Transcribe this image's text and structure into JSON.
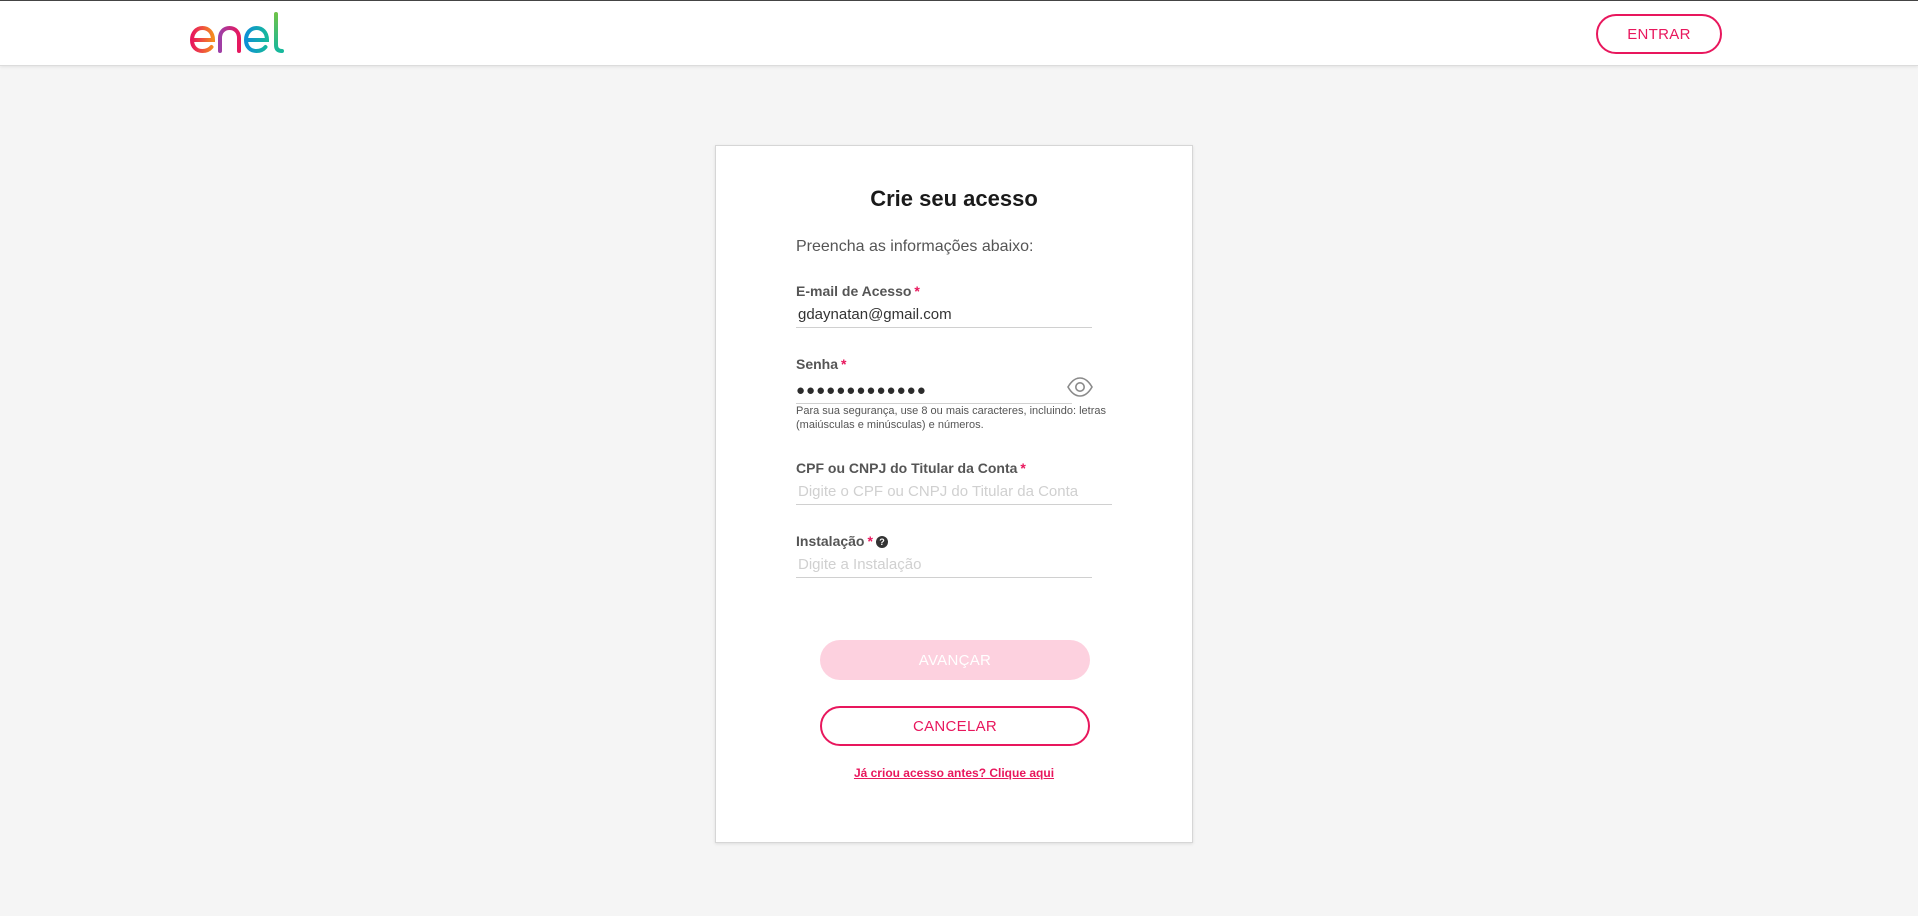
{
  "header": {
    "logo_text": "enel",
    "entrar_label": "ENTRAR"
  },
  "form": {
    "title": "Crie seu acesso",
    "subtitle": "Preencha as informações abaixo:",
    "email": {
      "label": "E-mail de Acesso",
      "required_mark": "*",
      "value": "gdaynatan@gmail.com"
    },
    "password": {
      "label": "Senha",
      "required_mark": "*",
      "masked_value": "●●●●●●●●●●●●●",
      "hint": "Para sua segurança, use 8 ou mais caracteres, incluindo: letras (maiúsculas e minúsculas) e números."
    },
    "cpf": {
      "label": "CPF ou CNPJ do Titular da Conta",
      "required_mark": "*",
      "placeholder": "Digite o CPF ou CNPJ do Titular da Conta"
    },
    "instalacao": {
      "label": "Instalação",
      "required_mark": "*",
      "help_icon": "?",
      "placeholder": "Digite a Instalação"
    },
    "avancar_label": "AVANÇAR",
    "cancelar_label": "CANCELAR",
    "login_link": "Já criou acesso antes? Clique aqui"
  },
  "colors": {
    "brand": "#e8175d",
    "brand_disabled": "#fdd1df",
    "background": "#f5f5f5"
  },
  "icons": {
    "password_toggle": "eye-icon",
    "help": "help-icon"
  }
}
